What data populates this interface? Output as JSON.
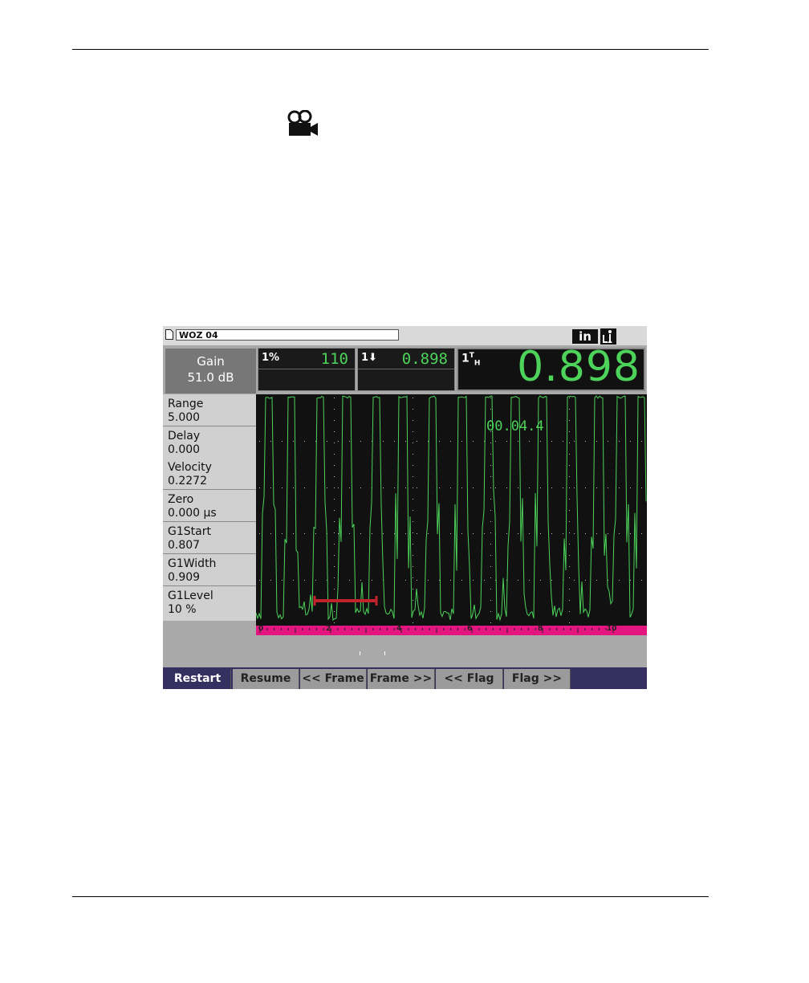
{
  "file": {
    "name": "WOZ 04"
  },
  "header": {
    "unit": "in"
  },
  "gain": {
    "label": "Gain",
    "value": "51.0 dB"
  },
  "readings": [
    {
      "label": "1%",
      "value": "110"
    },
    {
      "label": "1⬇",
      "value": "0.898"
    }
  ],
  "main_reading": {
    "label": "1TH",
    "value": "0.898"
  },
  "params": [
    {
      "name": "Range",
      "value": "5.000"
    },
    {
      "name": "Delay",
      "value": "0.000"
    },
    {
      "name": "Velocity",
      "value": "0.2272"
    },
    {
      "name": "Zero",
      "value": "0.000 µs"
    },
    {
      "name": "G1Start",
      "value": "0.807"
    },
    {
      "name": "G1Width",
      "value": "0.909"
    },
    {
      "name": "G1Level",
      "value": "10 %"
    }
  ],
  "waveform": {
    "timestamp": "00.04.4",
    "scale_labels": [
      "0",
      "2",
      "4",
      "6",
      "8",
      "10"
    ],
    "gate_color": "#c0232b",
    "signal_color": "#4dd35a"
  },
  "softkeys": [
    {
      "label": "Restart",
      "active": true
    },
    {
      "label": "Resume"
    },
    {
      "label": "<< Frame"
    },
    {
      "label": "Frame >>"
    },
    {
      "label": "<< Flag"
    },
    {
      "label": "Flag >>"
    }
  ]
}
